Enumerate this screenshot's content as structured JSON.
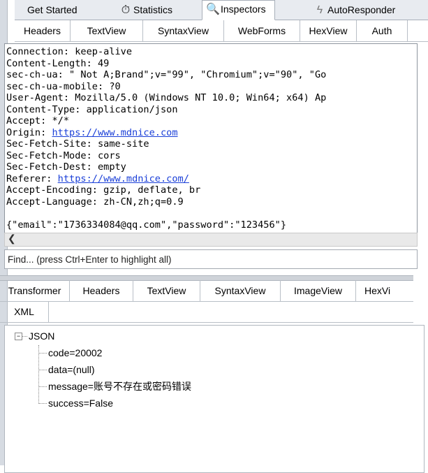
{
  "main_tabs": [
    {
      "label": "Get Started",
      "icon": "none"
    },
    {
      "label": "Statistics",
      "icon": "stopwatch-icon"
    },
    {
      "label": "Inspectors",
      "icon": "magnifier-icon"
    },
    {
      "label": "AutoResponder",
      "icon": "lightning-icon"
    }
  ],
  "request_tabs": [
    "Headers",
    "TextView",
    "SyntaxView",
    "WebForms",
    "HexView",
    "Auth"
  ],
  "raw": {
    "lines_before": "Connection: keep-alive\nContent-Length: 49\nsec-ch-ua: \" Not A;Brand\";v=\"99\", \"Chromium\";v=\"90\", \"Go\nsec-ch-ua-mobile: ?0\nUser-Agent: Mozilla/5.0 (Windows NT 10.0; Win64; x64) Ap\nContent-Type: application/json\nAccept: */*",
    "origin_label": "Origin: ",
    "origin_url": "https://www.mdnice.com",
    "lines_middle": "Sec-Fetch-Site: same-site\nSec-Fetch-Mode: cors\nSec-Fetch-Dest: empty",
    "referer_label": "Referer: ",
    "referer_url": "https://www.mdnice.com/",
    "lines_after": "Accept-Encoding: gzip, deflate, br\nAccept-Language: zh-CN,zh;q=0.9\n\n{\"email\":\"1736334084@qq.com\",\"password\":\"123456\"}"
  },
  "find_placeholder": "Find... (press Ctrl+Enter to highlight all)",
  "response_tabs": [
    "Transformer",
    "Headers",
    "TextView",
    "SyntaxView",
    "ImageView",
    "HexVi"
  ],
  "response_tabs_row2": [
    "XML"
  ],
  "tree": {
    "root": "JSON",
    "expander": "−",
    "children": [
      "code=20002",
      "data=(null)",
      "message=账号不存在或密码错误",
      "success=False"
    ]
  }
}
